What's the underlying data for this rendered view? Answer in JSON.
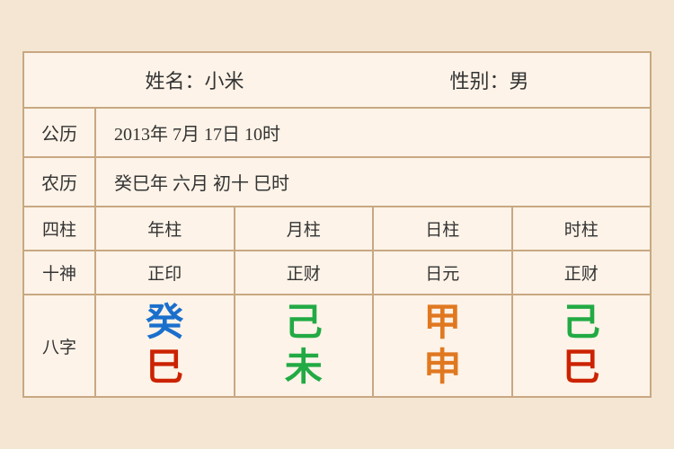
{
  "header": {
    "name_label": "姓名：小米",
    "gender_label": "性别：男"
  },
  "gong_li": {
    "label": "公历",
    "value": "2013年 7月 17日 10时"
  },
  "nong_li": {
    "label": "农历",
    "value": "癸巳年 六月 初十 巳时"
  },
  "sizhu": {
    "label": "四柱",
    "columns": [
      "年柱",
      "月柱",
      "日柱",
      "时柱"
    ]
  },
  "shishen": {
    "label": "十神",
    "columns": [
      "正印",
      "正财",
      "日元",
      "正财"
    ]
  },
  "bazi": {
    "label": "八字",
    "columns": [
      {
        "top": "癸",
        "top_color": "blue",
        "bottom": "巳",
        "bottom_color": "red"
      },
      {
        "top": "己",
        "top_color": "green",
        "bottom": "未",
        "bottom_color": "green"
      },
      {
        "top": "甲",
        "top_color": "orange",
        "bottom": "申",
        "bottom_color": "orange"
      },
      {
        "top": "己",
        "top_color": "green",
        "bottom": "巳",
        "bottom_color": "red"
      }
    ]
  }
}
